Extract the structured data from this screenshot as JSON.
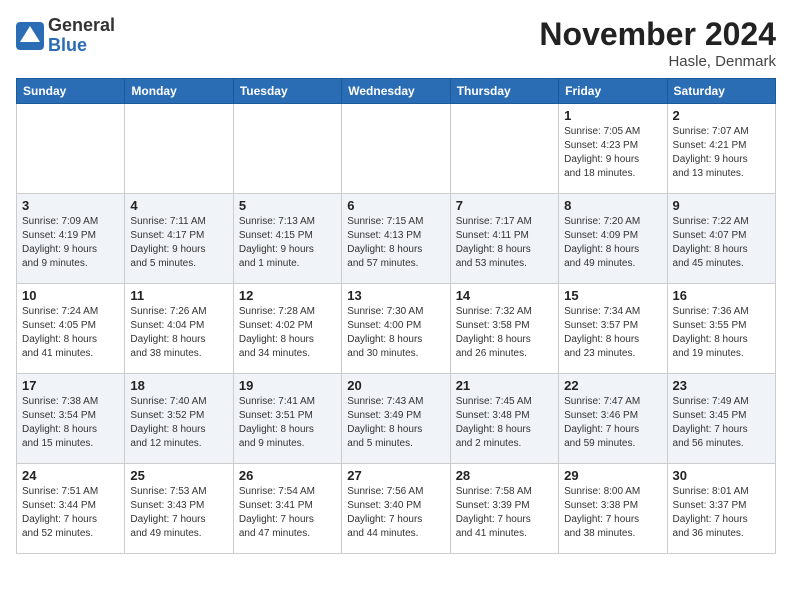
{
  "header": {
    "logo_general": "General",
    "logo_blue": "Blue",
    "month_title": "November 2024",
    "location": "Hasle, Denmark"
  },
  "weekdays": [
    "Sunday",
    "Monday",
    "Tuesday",
    "Wednesday",
    "Thursday",
    "Friday",
    "Saturday"
  ],
  "weeks": [
    [
      {
        "day": "",
        "detail": ""
      },
      {
        "day": "",
        "detail": ""
      },
      {
        "day": "",
        "detail": ""
      },
      {
        "day": "",
        "detail": ""
      },
      {
        "day": "",
        "detail": ""
      },
      {
        "day": "1",
        "detail": "Sunrise: 7:05 AM\nSunset: 4:23 PM\nDaylight: 9 hours\nand 18 minutes."
      },
      {
        "day": "2",
        "detail": "Sunrise: 7:07 AM\nSunset: 4:21 PM\nDaylight: 9 hours\nand 13 minutes."
      }
    ],
    [
      {
        "day": "3",
        "detail": "Sunrise: 7:09 AM\nSunset: 4:19 PM\nDaylight: 9 hours\nand 9 minutes."
      },
      {
        "day": "4",
        "detail": "Sunrise: 7:11 AM\nSunset: 4:17 PM\nDaylight: 9 hours\nand 5 minutes."
      },
      {
        "day": "5",
        "detail": "Sunrise: 7:13 AM\nSunset: 4:15 PM\nDaylight: 9 hours\nand 1 minute."
      },
      {
        "day": "6",
        "detail": "Sunrise: 7:15 AM\nSunset: 4:13 PM\nDaylight: 8 hours\nand 57 minutes."
      },
      {
        "day": "7",
        "detail": "Sunrise: 7:17 AM\nSunset: 4:11 PM\nDaylight: 8 hours\nand 53 minutes."
      },
      {
        "day": "8",
        "detail": "Sunrise: 7:20 AM\nSunset: 4:09 PM\nDaylight: 8 hours\nand 49 minutes."
      },
      {
        "day": "9",
        "detail": "Sunrise: 7:22 AM\nSunset: 4:07 PM\nDaylight: 8 hours\nand 45 minutes."
      }
    ],
    [
      {
        "day": "10",
        "detail": "Sunrise: 7:24 AM\nSunset: 4:05 PM\nDaylight: 8 hours\nand 41 minutes."
      },
      {
        "day": "11",
        "detail": "Sunrise: 7:26 AM\nSunset: 4:04 PM\nDaylight: 8 hours\nand 38 minutes."
      },
      {
        "day": "12",
        "detail": "Sunrise: 7:28 AM\nSunset: 4:02 PM\nDaylight: 8 hours\nand 34 minutes."
      },
      {
        "day": "13",
        "detail": "Sunrise: 7:30 AM\nSunset: 4:00 PM\nDaylight: 8 hours\nand 30 minutes."
      },
      {
        "day": "14",
        "detail": "Sunrise: 7:32 AM\nSunset: 3:58 PM\nDaylight: 8 hours\nand 26 minutes."
      },
      {
        "day": "15",
        "detail": "Sunrise: 7:34 AM\nSunset: 3:57 PM\nDaylight: 8 hours\nand 23 minutes."
      },
      {
        "day": "16",
        "detail": "Sunrise: 7:36 AM\nSunset: 3:55 PM\nDaylight: 8 hours\nand 19 minutes."
      }
    ],
    [
      {
        "day": "17",
        "detail": "Sunrise: 7:38 AM\nSunset: 3:54 PM\nDaylight: 8 hours\nand 15 minutes."
      },
      {
        "day": "18",
        "detail": "Sunrise: 7:40 AM\nSunset: 3:52 PM\nDaylight: 8 hours\nand 12 minutes."
      },
      {
        "day": "19",
        "detail": "Sunrise: 7:41 AM\nSunset: 3:51 PM\nDaylight: 8 hours\nand 9 minutes."
      },
      {
        "day": "20",
        "detail": "Sunrise: 7:43 AM\nSunset: 3:49 PM\nDaylight: 8 hours\nand 5 minutes."
      },
      {
        "day": "21",
        "detail": "Sunrise: 7:45 AM\nSunset: 3:48 PM\nDaylight: 8 hours\nand 2 minutes."
      },
      {
        "day": "22",
        "detail": "Sunrise: 7:47 AM\nSunset: 3:46 PM\nDaylight: 7 hours\nand 59 minutes."
      },
      {
        "day": "23",
        "detail": "Sunrise: 7:49 AM\nSunset: 3:45 PM\nDaylight: 7 hours\nand 56 minutes."
      }
    ],
    [
      {
        "day": "24",
        "detail": "Sunrise: 7:51 AM\nSunset: 3:44 PM\nDaylight: 7 hours\nand 52 minutes."
      },
      {
        "day": "25",
        "detail": "Sunrise: 7:53 AM\nSunset: 3:43 PM\nDaylight: 7 hours\nand 49 minutes."
      },
      {
        "day": "26",
        "detail": "Sunrise: 7:54 AM\nSunset: 3:41 PM\nDaylight: 7 hours\nand 47 minutes."
      },
      {
        "day": "27",
        "detail": "Sunrise: 7:56 AM\nSunset: 3:40 PM\nDaylight: 7 hours\nand 44 minutes."
      },
      {
        "day": "28",
        "detail": "Sunrise: 7:58 AM\nSunset: 3:39 PM\nDaylight: 7 hours\nand 41 minutes."
      },
      {
        "day": "29",
        "detail": "Sunrise: 8:00 AM\nSunset: 3:38 PM\nDaylight: 7 hours\nand 38 minutes."
      },
      {
        "day": "30",
        "detail": "Sunrise: 8:01 AM\nSunset: 3:37 PM\nDaylight: 7 hours\nand 36 minutes."
      }
    ]
  ]
}
